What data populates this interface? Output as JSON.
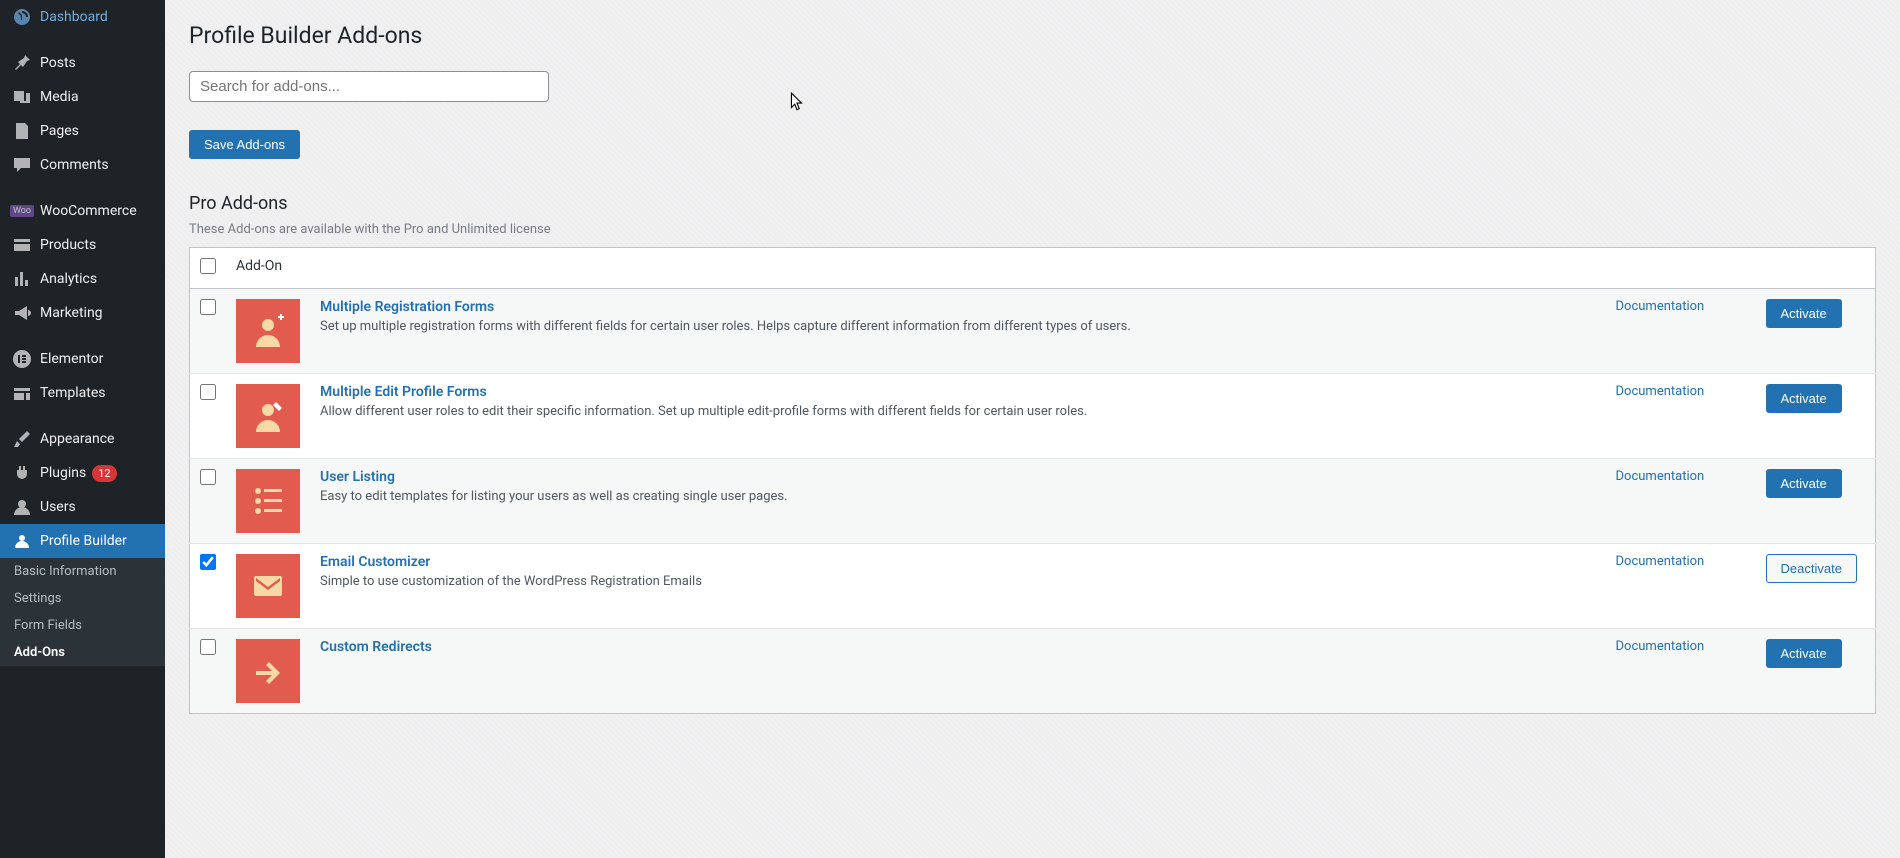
{
  "sidebar": {
    "items": [
      {
        "label": "Dashboard"
      },
      {
        "label": "Posts"
      },
      {
        "label": "Media"
      },
      {
        "label": "Pages"
      },
      {
        "label": "Comments"
      },
      {
        "label": "WooCommerce"
      },
      {
        "label": "Products"
      },
      {
        "label": "Analytics"
      },
      {
        "label": "Marketing"
      },
      {
        "label": "Elementor"
      },
      {
        "label": "Templates"
      },
      {
        "label": "Appearance"
      },
      {
        "label": "Plugins",
        "badge": "12"
      },
      {
        "label": "Users"
      },
      {
        "label": "Profile Builder"
      }
    ],
    "submenu": [
      {
        "label": "Basic Information"
      },
      {
        "label": "Settings"
      },
      {
        "label": "Form Fields"
      },
      {
        "label": "Add-Ons"
      }
    ]
  },
  "page": {
    "title": "Profile Builder Add-ons",
    "search_placeholder": "Search for add-ons...",
    "save_button": "Save Add-ons"
  },
  "section": {
    "heading": "Pro Add-ons",
    "subtitle": "These Add-ons are available with the Pro and Unlimited license",
    "col_addon": "Add-On",
    "doc_label": "Documentation",
    "activate_label": "Activate",
    "deactivate_label": "Deactivate"
  },
  "addons": [
    {
      "title": "Multiple Registration Forms",
      "desc": "Set up multiple registration forms with different fields for certain user roles. Helps capture different information from different types of users.",
      "checked": false,
      "active": false
    },
    {
      "title": "Multiple Edit Profile Forms",
      "desc": "Allow different user roles to edit their specific information. Set up multiple edit-profile forms with different fields for certain user roles.",
      "checked": false,
      "active": false
    },
    {
      "title": "User Listing",
      "desc": "Easy to edit templates for listing your users as well as creating single user pages.",
      "checked": false,
      "active": false
    },
    {
      "title": "Email Customizer",
      "desc": "Simple to use customization of the WordPress Registration Emails",
      "checked": true,
      "active": true
    },
    {
      "title": "Custom Redirects",
      "desc": "",
      "checked": false,
      "active": false
    }
  ]
}
